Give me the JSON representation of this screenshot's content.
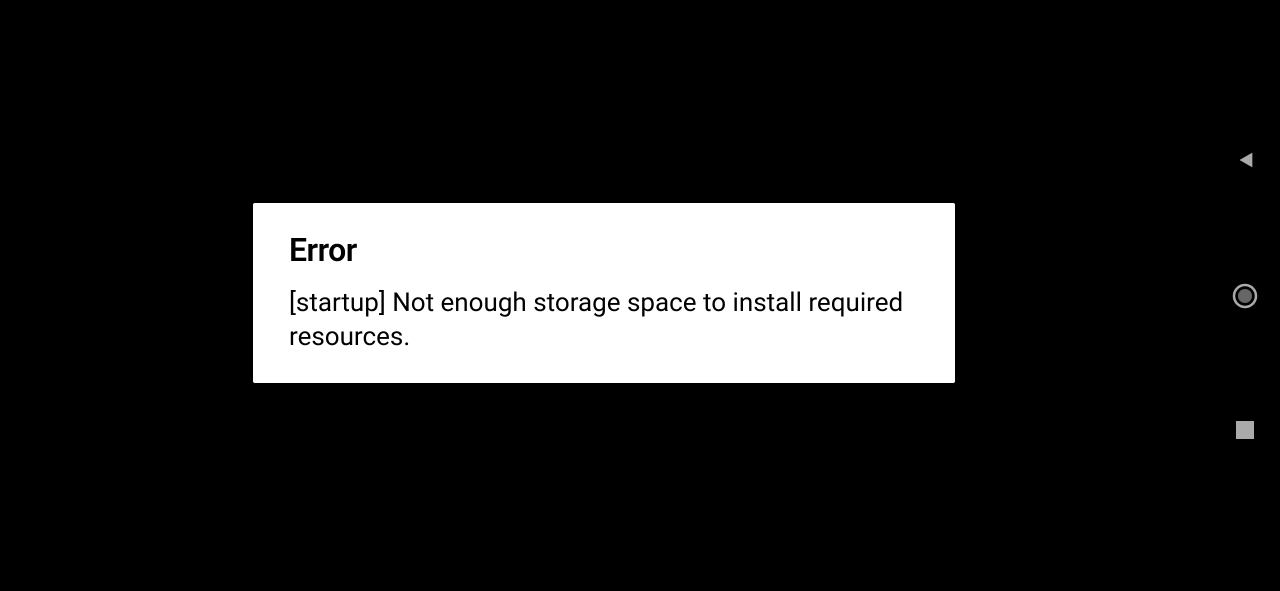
{
  "dialog": {
    "title": "Error",
    "message": "[startup] Not enough storage space to install required resources."
  },
  "nav": {
    "back": "back",
    "home": "home",
    "recent": "recent"
  }
}
